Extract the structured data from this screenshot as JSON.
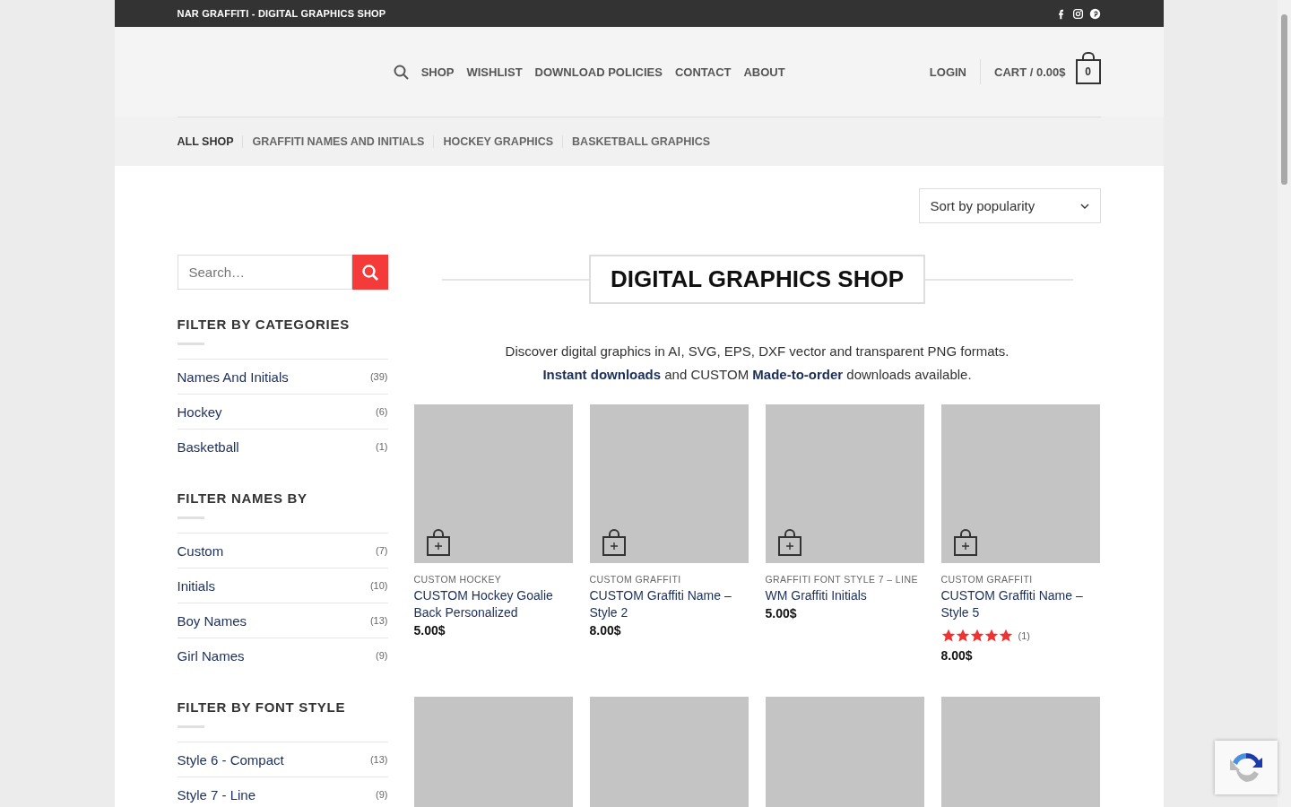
{
  "top_bar": {
    "title": "NAR GRAFFITI - DIGITAL GRAPHICS SHOP"
  },
  "header": {
    "nav": [
      "SHOP",
      "WISHLIST",
      "DOWNLOAD POLICIES",
      "CONTACT",
      "ABOUT"
    ],
    "login": "LOGIN",
    "cart": "CART / 0.00$",
    "cart_count": "0"
  },
  "sub_nav": [
    {
      "label": "ALL SHOP",
      "selected": true
    },
    {
      "label": "GRAFFITI NAMES AND INITIALS",
      "selected": false
    },
    {
      "label": "HOCKEY GRAPHICS",
      "selected": false
    },
    {
      "label": "BASKETBALL GRAPHICS",
      "selected": false
    }
  ],
  "sort": {
    "value": "Sort by popularity"
  },
  "search": {
    "placeholder": "Search…"
  },
  "filters": [
    {
      "title": "FILTER BY CATEGORIES",
      "items": [
        {
          "label": "Names And Initials",
          "count": "(39)"
        },
        {
          "label": "Hockey",
          "count": "(6)"
        },
        {
          "label": "Basketball",
          "count": "(1)"
        }
      ]
    },
    {
      "title": "FILTER NAMES BY",
      "items": [
        {
          "label": "Custom",
          "count": "(7)"
        },
        {
          "label": "Initials",
          "count": "(10)"
        },
        {
          "label": "Boy Names",
          "count": "(13)"
        },
        {
          "label": "Girl Names",
          "count": "(9)"
        }
      ]
    },
    {
      "title": "FILTER BY FONT STYLE",
      "items": [
        {
          "label": "Style 6 - Compact",
          "count": "(13)"
        },
        {
          "label": "Style 7 - Line",
          "count": "(9)"
        }
      ]
    }
  ],
  "intro": {
    "title": "DIGITAL GRAPHICS SHOP",
    "line_1": "Discover digital graphics in AI, SVG, EPS, DXF vector and transparent PNG formats.",
    "line_2": "**Instant downloads** and CUSTOM **Made-to-order** downloads available."
  },
  "products": [
    {
      "kind": "product",
      "category": "CUSTOM HOCKEY",
      "name": "CUSTOM Hockey Goalie Back Personalized",
      "price": "5.00$"
    },
    {
      "kind": "product",
      "category": "CUSTOM GRAFFITI",
      "name": "CUSTOM Graffiti Name – Style 2",
      "price": "8.00$"
    },
    {
      "kind": "product",
      "category": "GRAFFITI FONT STYLE 7 – LINE",
      "name": "WM Graffiti Initials",
      "price": "5.00$"
    },
    {
      "kind": "product",
      "category": "CUSTOM GRAFFITI",
      "name": "CUSTOM Graffiti Name – Style 5",
      "stars": 5,
      "reviews": "(1)",
      "price": "8.00$"
    },
    {
      "kind": "cut"
    },
    {
      "kind": "cut"
    },
    {
      "kind": "cut"
    },
    {
      "kind": "cut"
    }
  ]
}
